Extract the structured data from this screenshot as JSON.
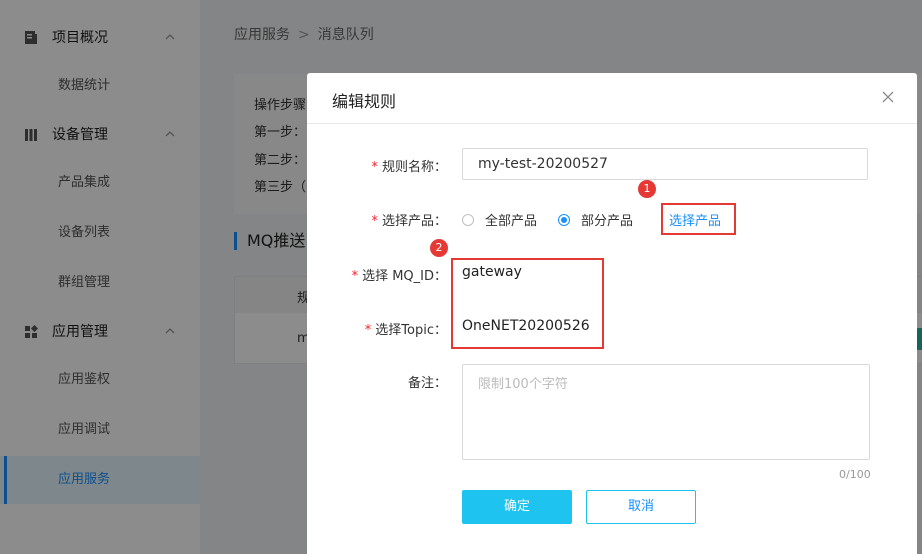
{
  "sidebar": {
    "groups": [
      {
        "label": "项目概况",
        "icon": "document-icon"
      },
      {
        "label": "设备管理",
        "icon": "bars-icon"
      },
      {
        "label": "应用管理",
        "icon": "apps-icon"
      }
    ],
    "items": [
      {
        "label": "数据统计"
      },
      {
        "label": "产品集成"
      },
      {
        "label": "设备列表"
      },
      {
        "label": "群组管理"
      },
      {
        "label": "应用鉴权"
      },
      {
        "label": "应用调试"
      },
      {
        "label": "应用服务",
        "active": true
      }
    ]
  },
  "breadcrumb": {
    "items": [
      "应用服务",
      "消息队列"
    ]
  },
  "steps": {
    "title": "操作步骤",
    "lines": [
      "第一步：",
      "第二步：",
      "第三步（"
    ]
  },
  "section": {
    "title": "MQ推送"
  },
  "table": {
    "header": "规",
    "cell": "m"
  },
  "modal": {
    "title": "编辑规则",
    "fields": {
      "rule_name": {
        "label": "规则名称：",
        "value": "my-test-20200527"
      },
      "product": {
        "label": "选择产品：",
        "options": [
          {
            "label": "全部产品",
            "selected": false
          },
          {
            "label": "部分产品",
            "selected": true
          }
        ],
        "link": "选择产品"
      },
      "mq_id": {
        "label": "选择 MQ_ID：",
        "value": "gateway"
      },
      "topic": {
        "label": "选择Topic：",
        "value": "OneNET20200526"
      },
      "note": {
        "label": "备注：",
        "placeholder": "限制100个字符",
        "counter": "0/100"
      }
    },
    "confirm_label": "确定",
    "cancel_label": "取消"
  },
  "annotations": {
    "badge_1": "1",
    "badge_2": "2"
  },
  "colors": {
    "accent": "#1890ff",
    "primary_button": "#1ec3ef",
    "highlight": "#e53935"
  }
}
